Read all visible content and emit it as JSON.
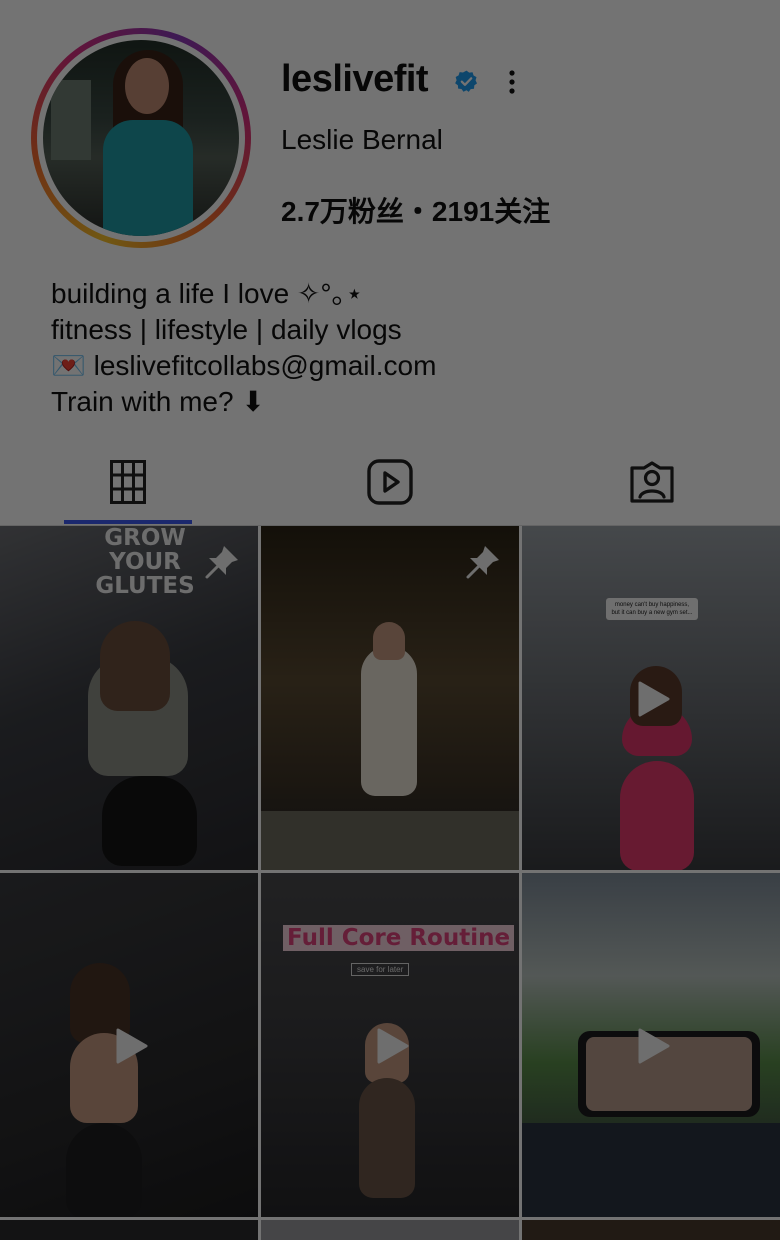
{
  "profile": {
    "username": "leslivefit",
    "full_name": "Leslie Bernal",
    "stats": "2.7万粉丝・2191关注",
    "bio": [
      "building a life I love ✧°｡⋆",
      "fitness | lifestyle | daily vlogs",
      "💌  leslivefitcollabs@gmail.com",
      "Train with me? ⬇"
    ],
    "verified_icon": "verified-badge-icon",
    "more_icon": "more-vertical-icon"
  },
  "tabs": [
    {
      "name": "posts",
      "icon": "grid-icon",
      "selected": true
    },
    {
      "name": "reels",
      "icon": "reels-icon",
      "selected": false
    },
    {
      "name": "tagged",
      "icon": "tagged-icon",
      "selected": false
    }
  ],
  "posts": [
    {
      "overlay_text": "GROW YOUR GLUTES",
      "pinned": true,
      "video": false
    },
    {
      "overlay_text": "",
      "pinned": true,
      "video": false
    },
    {
      "overlay_text": "money can't buy happiness, but it can buy a new gym set...",
      "pinned": false,
      "video": true
    },
    {
      "overlay_text": "",
      "pinned": false,
      "video": true
    },
    {
      "overlay_text": "Full Core Routine",
      "sub_text": "save for later",
      "pinned": false,
      "video": true
    },
    {
      "overlay_text": "",
      "pinned": false,
      "video": true
    }
  ],
  "colors": {
    "accent": "#3d5af1",
    "verified": "#1d9bf0",
    "overlay": "#000000"
  }
}
